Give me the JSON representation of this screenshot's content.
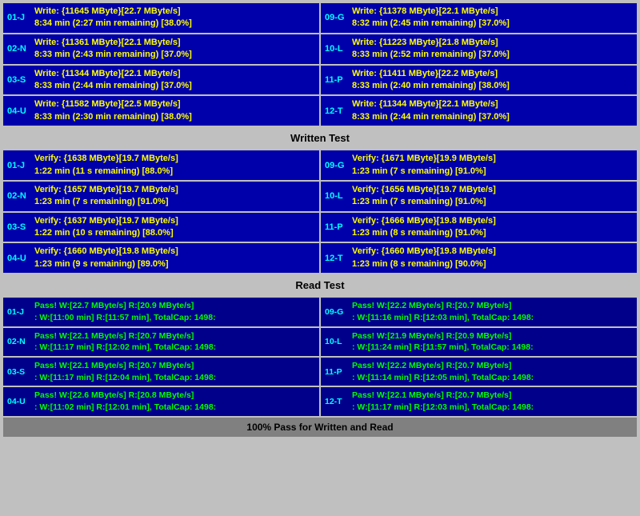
{
  "write_section": {
    "rows_left": [
      {
        "label": "01-J",
        "line1": "Write: {11645 MByte}[22.7 MByte/s]",
        "line2": "8:34 min (2:27 min remaining)  [38.0%]"
      },
      {
        "label": "02-N",
        "line1": "Write: {11361 MByte}[22.1 MByte/s]",
        "line2": "8:33 min (2:43 min remaining)  [37.0%]"
      },
      {
        "label": "03-S",
        "line1": "Write: {11344 MByte}[22.1 MByte/s]",
        "line2": "8:33 min (2:44 min remaining)  [37.0%]"
      },
      {
        "label": "04-U",
        "line1": "Write: {11582 MByte}[22.5 MByte/s]",
        "line2": "8:33 min (2:30 min remaining)  [38.0%]"
      }
    ],
    "rows_right": [
      {
        "label": "09-G",
        "line1": "Write: {11378 MByte}[22.1 MByte/s]",
        "line2": "8:32 min (2:45 min remaining)  [37.0%]"
      },
      {
        "label": "10-L",
        "line1": "Write: {11223 MByte}[21.8 MByte/s]",
        "line2": "8:33 min (2:52 min remaining)  [37.0%]"
      },
      {
        "label": "11-P",
        "line1": "Write: {11411 MByte}[22.2 MByte/s]",
        "line2": "8:33 min (2:40 min remaining)  [38.0%]"
      },
      {
        "label": "12-T",
        "line1": "Write: {11344 MByte}[22.1 MByte/s]",
        "line2": "8:33 min (2:44 min remaining)  [37.0%]"
      }
    ],
    "header": "Written Test"
  },
  "verify_section": {
    "rows_left": [
      {
        "label": "01-J",
        "line1": "Verify: {1638 MByte}[19.7 MByte/s]",
        "line2": "1:22 min (11 s remaining)  [88.0%]"
      },
      {
        "label": "02-N",
        "line1": "Verify: {1657 MByte}[19.7 MByte/s]",
        "line2": "1:23 min (7 s remaining)  [91.0%]"
      },
      {
        "label": "03-S",
        "line1": "Verify: {1637 MByte}[19.7 MByte/s]",
        "line2": "1:22 min (10 s remaining)  [88.0%]"
      },
      {
        "label": "04-U",
        "line1": "Verify: {1660 MByte}[19.8 MByte/s]",
        "line2": "1:23 min (9 s remaining)  [89.0%]"
      }
    ],
    "rows_right": [
      {
        "label": "09-G",
        "line1": "Verify: {1671 MByte}[19.9 MByte/s]",
        "line2": "1:23 min (7 s remaining)  [91.0%]"
      },
      {
        "label": "10-L",
        "line1": "Verify: {1656 MByte}[19.7 MByte/s]",
        "line2": "1:23 min (7 s remaining)  [91.0%]"
      },
      {
        "label": "11-P",
        "line1": "Verify: {1666 MByte}[19.8 MByte/s]",
        "line2": "1:23 min (8 s remaining)  [91.0%]"
      },
      {
        "label": "12-T",
        "line1": "Verify: {1660 MByte}[19.8 MByte/s]",
        "line2": "1:23 min (8 s remaining)  [90.0%]"
      }
    ],
    "header": "Read Test"
  },
  "pass_section": {
    "rows_left": [
      {
        "label": "01-J",
        "line1": "Pass! W:[22.7 MByte/s] R:[20.9 MByte/s]",
        "line2": ": W:[11:00 min] R:[11:57 min], TotalCap: 1498:"
      },
      {
        "label": "02-N",
        "line1": "Pass! W:[22.1 MByte/s] R:[20.7 MByte/s]",
        "line2": ": W:[11:17 min] R:[12:02 min], TotalCap: 1498:"
      },
      {
        "label": "03-S",
        "line1": "Pass! W:[22.1 MByte/s] R:[20.7 MByte/s]",
        "line2": ": W:[11:17 min] R:[12:04 min], TotalCap: 1498:"
      },
      {
        "label": "04-U",
        "line1": "Pass! W:[22.6 MByte/s] R:[20.8 MByte/s]",
        "line2": ": W:[11:02 min] R:[12:01 min], TotalCap: 1498:"
      }
    ],
    "rows_right": [
      {
        "label": "09-G",
        "line1": "Pass! W:[22.2 MByte/s] R:[20.7 MByte/s]",
        "line2": ": W:[11:16 min] R:[12:03 min], TotalCap: 1498:"
      },
      {
        "label": "10-L",
        "line1": "Pass! W:[21.9 MByte/s] R:[20.9 MByte/s]",
        "line2": ": W:[11:24 min] R:[11:57 min], TotalCap: 1498:"
      },
      {
        "label": "11-P",
        "line1": "Pass! W:[22.2 MByte/s] R:[20.7 MByte/s]",
        "line2": ": W:[11:14 min] R:[12:05 min], TotalCap: 1498:"
      },
      {
        "label": "12-T",
        "line1": "Pass! W:[22.1 MByte/s] R:[20.7 MByte/s]",
        "line2": ": W:[11:17 min] R:[12:03 min], TotalCap: 1498:"
      }
    ],
    "footer": "100% Pass for Written and Read"
  }
}
